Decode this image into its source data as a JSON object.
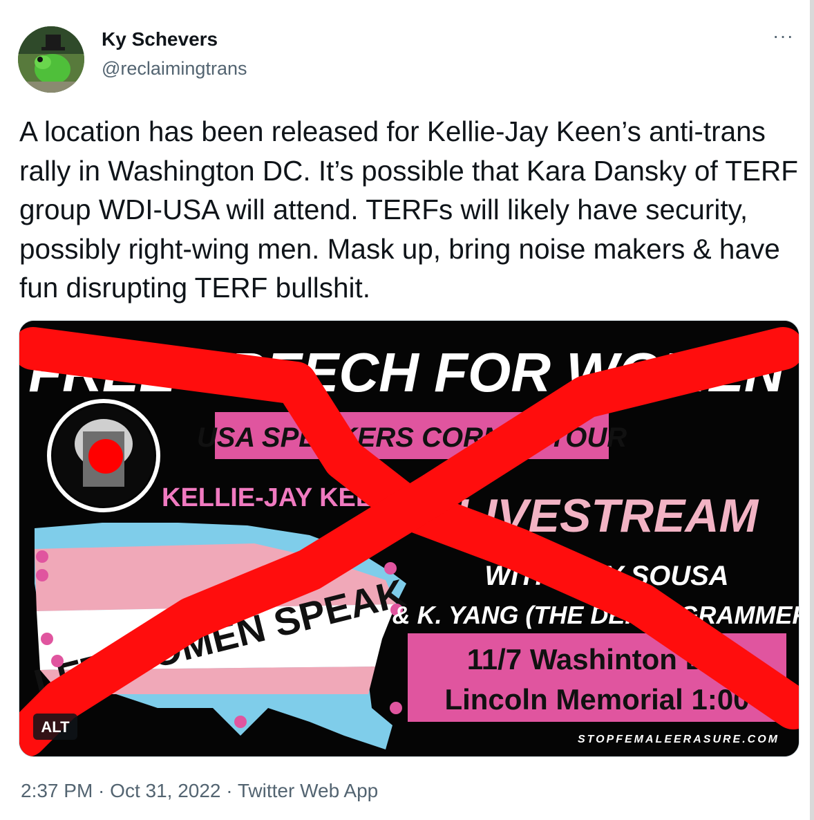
{
  "tweet": {
    "author_name": "Ky Schevers",
    "author_handle": "@reclaimingtrans",
    "more_label": "···",
    "text": "A location has been released for Kellie-Jay Keen’s anti-trans rally in Washington DC. It’s possible that Kara Dansky of TERF group WDI-USA will attend. TERFs will likely have security, possibly right-wing men. Mask up, bring noise makers & have fun disrupting TERF bullshit.",
    "timestamp": "2:37 PM · Oct 31, 2022 · Twitter Web App"
  },
  "image": {
    "headline": "FREE SPEECH FOR WOMEN",
    "subheadline": "USA SPEAKERS CORNER TOUR",
    "speaker_label": "KELLIE-JAY KEEN",
    "banner_text": "LET WOMEN SPEAK",
    "livestream": "LIVESTREAM",
    "with_line_1": "WITH AMY SOUSA",
    "with_line_2": "& K. YANG (THE DEPROGRAMMER)",
    "event_line_1": "11/7 Washinton DC",
    "event_line_2": "Lincoln Memorial 1:00",
    "website": "STOPFEMALEERASURE.COM",
    "alt_badge": "ALT",
    "colors": {
      "pink": "#e0559f",
      "light_pink": "#f0a8b8",
      "light_blue": "#7fcdea",
      "red_x": "#ff0d0d"
    }
  }
}
